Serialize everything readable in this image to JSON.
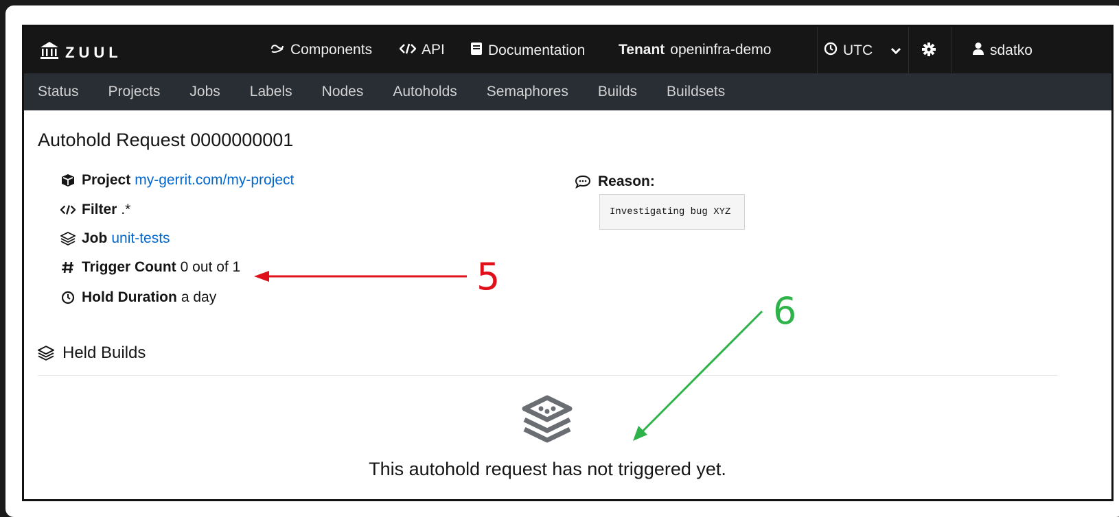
{
  "app": {
    "brand": "ZUUL",
    "top_links": [
      {
        "label": "Components",
        "icon": "components-icon"
      },
      {
        "label": "API",
        "icon": "code-icon"
      },
      {
        "label": "Documentation",
        "icon": "book-icon"
      }
    ],
    "tenant_label": "Tenant",
    "tenant_name": "openinfra-demo",
    "timezone": "UTC",
    "user": "sdatko"
  },
  "nav": [
    "Status",
    "Projects",
    "Jobs",
    "Labels",
    "Nodes",
    "Autoholds",
    "Semaphores",
    "Builds",
    "Buildsets"
  ],
  "autohold": {
    "title": "Autohold Request 0000000001",
    "project_label": "Project",
    "project_value": "my-gerrit.com/my-project",
    "filter_label": "Filter",
    "filter_value": ".*",
    "job_label": "Job",
    "job_value": "unit-tests",
    "trigger_label": "Trigger Count",
    "trigger_value": "0 out of 1",
    "duration_label": "Hold Duration",
    "duration_value": "a day",
    "reason_label": "Reason:",
    "reason_value": "Investigating bug XYZ"
  },
  "held_builds": {
    "heading": "Held Builds",
    "empty_message": "This autohold request has not triggered yet."
  },
  "annotations": [
    {
      "label": "5",
      "color": "#e0101a"
    },
    {
      "label": "6",
      "color": "#2db34a"
    }
  ]
}
